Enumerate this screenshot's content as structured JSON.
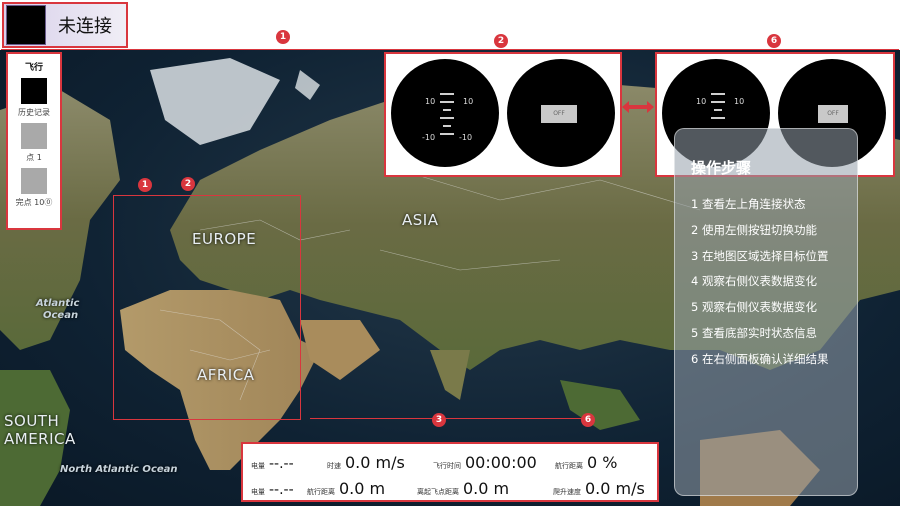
{
  "header": {
    "connection_status": "未连接"
  },
  "left_panel": {
    "title": "飞行",
    "buttons": [
      {
        "label": "历史记录"
      },
      {
        "label": "点 1"
      },
      {
        "label": "完点 10⓪"
      }
    ]
  },
  "map": {
    "labels": {
      "europe": "EUROPE",
      "asia": "ASIA",
      "africa": "AFRICA",
      "south_america_1": "SOUTH",
      "south_america_2": "AMERICA",
      "atlantic_1": "Atlantic",
      "atlantic_2": "Ocean",
      "north_atlantic": "North Atlantic Ocean"
    }
  },
  "badges": {
    "b1": "1",
    "b2": "2",
    "b3": "3",
    "b6": "6",
    "map_b1": "1",
    "map_b2": "2",
    "map_b3": "3",
    "map_b6": "6"
  },
  "gauges": {
    "left": {
      "top_left": "10",
      "top_right": "10",
      "bottom_left": "-10",
      "bottom_right": "-10",
      "off_label": "OFF"
    },
    "right": {
      "top_left": "10",
      "top_right": "10",
      "off_label": "OFF"
    }
  },
  "stats": {
    "row1": [
      {
        "label": "电量",
        "value": "--.--"
      },
      {
        "label": "时速",
        "value": "0.0 m/s"
      },
      {
        "label": "飞行时间",
        "value": "00:00:00"
      },
      {
        "label": "航行距离",
        "value": "0 %"
      }
    ],
    "row2": [
      {
        "label": "电量",
        "value": "--.--"
      },
      {
        "label": "航行距离",
        "value": "0.0 m"
      },
      {
        "label": "离起飞点距离",
        "value": "0.0 m"
      },
      {
        "label": "爬升速度",
        "value": "0.0 m/s"
      }
    ]
  },
  "steps": {
    "title": "操作步骤",
    "items": [
      "1 查看左上角连接状态",
      "2 使用左侧按钮切换功能",
      "3 在地图区域选择目标位置",
      "4 观察右侧仪表数据变化",
      "5 观察右侧仪表数据变化",
      "5 查看底部实时状态信息",
      "6 在右侧面板确认详细结果"
    ]
  },
  "colors": {
    "accent_red": "#d9363e",
    "map_land": "#6d6f48",
    "map_ocean": "#13283a"
  }
}
